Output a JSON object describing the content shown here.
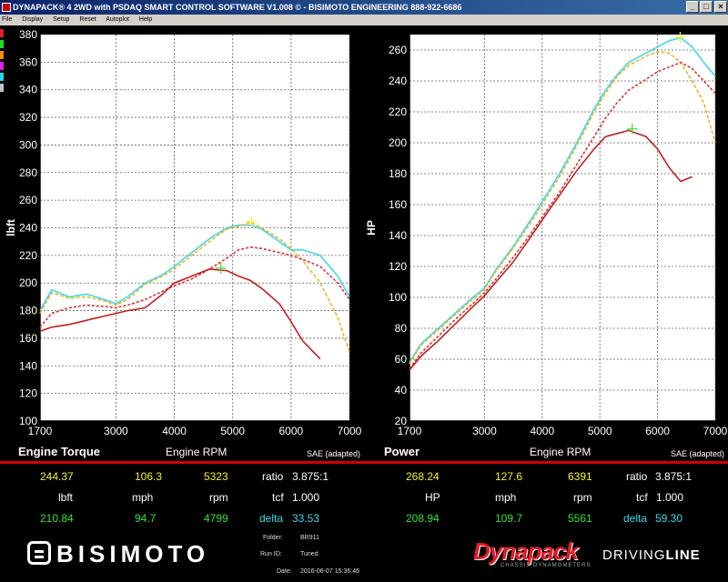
{
  "window": {
    "title": "DYNAPACK® 4 2WD with PSDAQ SMART CONTROL SOFTWARE V1.008 © - BISIMOTO ENGINEERING 888-922-6686",
    "buttons": [
      "_",
      "□",
      "×"
    ]
  },
  "menu": [
    "File",
    "Display",
    "Setup",
    "Reset",
    "Autoplot",
    "Help"
  ],
  "swatch_colors": [
    "#e02020",
    "#20e020",
    "#ff8800",
    "#e020e0",
    "#20d8e8",
    "#c0c0c0"
  ],
  "colors": {
    "run_tuned_cyan": "#3ed8e8",
    "run_tuned_yellow": "#e8b830",
    "run_base_red": "#c02020",
    "run_base_red2": "#e03030"
  },
  "torque_panel": {
    "title": "Engine Torque",
    "xlabel": "Engine RPM",
    "ylabel": "lbft",
    "note": "SAE (adapted)"
  },
  "power_panel": {
    "title": "Power",
    "xlabel": "Engine RPM",
    "ylabel": "HP",
    "note": "SAE (adapted)"
  },
  "chart_data": [
    {
      "type": "line",
      "title": "Engine Torque",
      "xlabel": "Engine RPM",
      "ylabel": "lbft",
      "xlim": [
        1700,
        7000
      ],
      "ylim": [
        100,
        380
      ],
      "xticks": [
        1700,
        3000,
        4000,
        5000,
        6000,
        7000
      ],
      "yticks": [
        100,
        120,
        140,
        160,
        180,
        200,
        220,
        240,
        260,
        280,
        300,
        320,
        340,
        360,
        380
      ],
      "grid": true,
      "x": [
        1700,
        1900,
        2200,
        2500,
        2800,
        3000,
        3200,
        3500,
        3800,
        4000,
        4300,
        4600,
        4900,
        5100,
        5300,
        5500,
        5800,
        6000,
        6200,
        6500,
        6800,
        7000
      ],
      "series": [
        {
          "color": "#3ed8e8",
          "values": [
            180,
            195,
            190,
            192,
            188,
            185,
            190,
            200,
            206,
            212,
            222,
            232,
            240,
            242,
            242,
            239,
            230,
            224,
            224,
            220,
            205,
            190
          ]
        },
        {
          "color": "#e8b830",
          "values": [
            178,
            193,
            189,
            190,
            187,
            184,
            188,
            199,
            205,
            210,
            220,
            230,
            239,
            241,
            244,
            240,
            232,
            225,
            216,
            200,
            175,
            150
          ]
        },
        {
          "color": "#e03030",
          "values": [
            168,
            178,
            182,
            184,
            183,
            182,
            184,
            188,
            194,
            198,
            203,
            210,
            218,
            224,
            226,
            225,
            222,
            220,
            217,
            212,
            200,
            188
          ]
        },
        {
          "color": "#c02020",
          "values": [
            165,
            168,
            170,
            173,
            176,
            178,
            180,
            182,
            192,
            200,
            205,
            210,
            209,
            205,
            202,
            196,
            185,
            172,
            158,
            145,
            null,
            null
          ]
        }
      ],
      "markers": [
        {
          "x": 5323,
          "y": 244.37,
          "color": "#f2f220"
        },
        {
          "x": 4799,
          "y": 210.84,
          "color": "#38e038"
        }
      ]
    },
    {
      "type": "line",
      "title": "Power",
      "xlabel": "Engine RPM",
      "ylabel": "HP",
      "xlim": [
        1700,
        7000
      ],
      "ylim": [
        20,
        270
      ],
      "xticks": [
        1700,
        3000,
        4000,
        5000,
        6000,
        7000
      ],
      "yticks": [
        20,
        40,
        60,
        80,
        100,
        120,
        140,
        160,
        180,
        200,
        220,
        240,
        260
      ],
      "grid": true,
      "x": [
        1700,
        1900,
        2200,
        2500,
        2800,
        3000,
        3200,
        3500,
        3800,
        4000,
        4300,
        4600,
        4900,
        5100,
        5300,
        5500,
        5800,
        6000,
        6200,
        6400,
        6600,
        6800,
        7000
      ],
      "series": [
        {
          "color": "#3ed8e8",
          "values": [
            58,
            70,
            80,
            90,
            100,
            106,
            118,
            133,
            150,
            162,
            180,
            200,
            222,
            234,
            244,
            252,
            258,
            262,
            266,
            268,
            262,
            252,
            243
          ]
        },
        {
          "color": "#e8b830",
          "values": [
            57,
            69,
            79,
            89,
            99,
            105,
            117,
            132,
            148,
            160,
            178,
            198,
            220,
            232,
            243,
            250,
            256,
            259,
            258,
            252,
            240,
            226,
            200
          ]
        },
        {
          "color": "#e03030",
          "values": [
            54,
            64,
            75,
            86,
            96,
            103,
            112,
            126,
            141,
            152,
            168,
            186,
            204,
            216,
            226,
            234,
            241,
            246,
            249,
            252,
            248,
            240,
            232
          ]
        },
        {
          "color": "#c02020",
          "values": [
            53,
            62,
            72,
            83,
            94,
            101,
            110,
            123,
            139,
            150,
            166,
            182,
            196,
            204,
            206,
            208,
            204,
            196,
            184,
            175,
            178,
            null,
            null
          ]
        }
      ],
      "markers": [
        {
          "x": 6391,
          "y": 268.24,
          "color": "#f2f220"
        },
        {
          "x": 5561,
          "y": 208.94,
          "color": "#38e038"
        }
      ]
    }
  ],
  "torque_readout": {
    "peak1_value": "244.37",
    "peak1_unit": "lbft",
    "speed1_value": "106.3",
    "speed_unit": "mph",
    "rpm1_value": "5323",
    "rpm_unit": "rpm",
    "ratio_label": "ratio",
    "ratio_value": "3.875:1",
    "tcf_label": "tcf",
    "tcf_value": "1.000",
    "peak2_value": "210.84",
    "speed2_value": "94.7",
    "rpm2_value": "4799",
    "delta_label": "delta",
    "delta_value": "33.53"
  },
  "power_readout": {
    "peak1_value": "268.24",
    "peak1_unit": "HP",
    "speed1_value": "127.6",
    "speed_unit": "mph",
    "rpm1_value": "6391",
    "rpm_unit": "rpm",
    "ratio_label": "ratio",
    "ratio_value": "3.875:1",
    "tcf_label": "tcf",
    "tcf_value": "1.000",
    "peak2_value": "208.94",
    "speed2_value": "109.7",
    "rpm2_value": "5561",
    "delta_label": "delta",
    "delta_value": "59.30"
  },
  "run_info": {
    "folder_label": "Folder:",
    "folder_value": "BR911",
    "runid_label": "Run ID:",
    "runid_value": "Tuned",
    "date_label": "Date:",
    "date_value": "2016-06-07 15:36:46"
  },
  "logos": {
    "bisimoto": "BISIMOTO",
    "dynapack": "Dynapack",
    "dynapack_sub": "CHASSIS DYNAMOMETERS",
    "drivingline_1": "DRIVING",
    "drivingline_2": "LINE"
  }
}
